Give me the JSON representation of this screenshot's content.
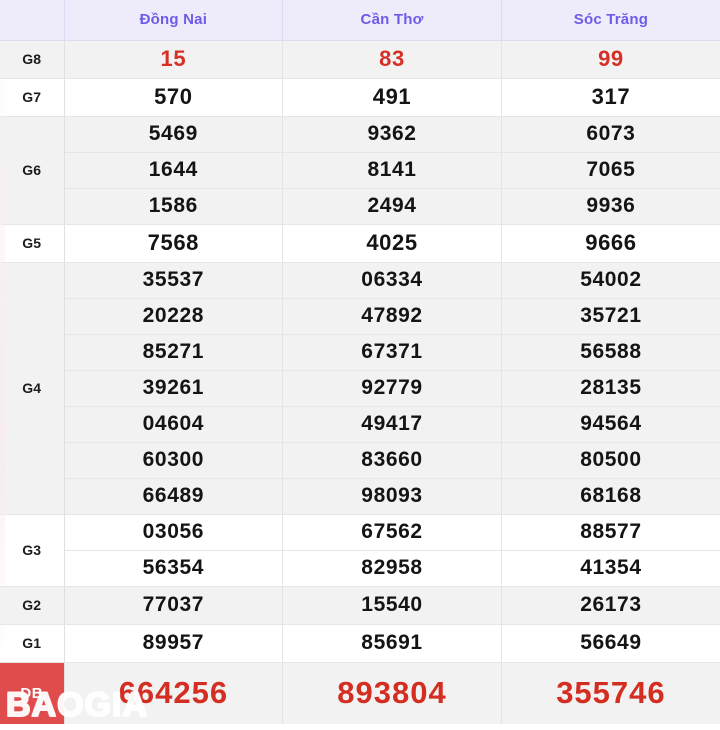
{
  "table": {
    "columns": [
      {
        "label": "Đồng Nai"
      },
      {
        "label": "Cần Thơ"
      },
      {
        "label": "Sóc Trăng"
      }
    ],
    "rows": [
      {
        "label": "G8",
        "style": "red",
        "shade": "shade",
        "values": [
          [
            "15"
          ],
          [
            "83"
          ],
          [
            "99"
          ]
        ]
      },
      {
        "label": "G7",
        "style": "g7",
        "shade": "plain",
        "values": [
          [
            "570"
          ],
          [
            "491"
          ],
          [
            "317"
          ]
        ]
      },
      {
        "label": "G6",
        "style": "normal",
        "shade": "shade",
        "values": [
          [
            "5469",
            "1644",
            "1586"
          ],
          [
            "9362",
            "8141",
            "2494"
          ],
          [
            "6073",
            "7065",
            "9936"
          ]
        ]
      },
      {
        "label": "G5",
        "style": "g5",
        "shade": "plain",
        "values": [
          [
            "7568"
          ],
          [
            "4025"
          ],
          [
            "9666"
          ]
        ]
      },
      {
        "label": "G4",
        "style": "normal",
        "shade": "shade",
        "values": [
          [
            "35537",
            "20228",
            "85271",
            "39261",
            "04604",
            "60300",
            "66489"
          ],
          [
            "06334",
            "47892",
            "67371",
            "92779",
            "49417",
            "83660",
            "98093"
          ],
          [
            "54002",
            "35721",
            "56588",
            "28135",
            "94564",
            "80500",
            "68168"
          ]
        ]
      },
      {
        "label": "G3",
        "style": "normal",
        "shade": "plain",
        "values": [
          [
            "03056",
            "56354"
          ],
          [
            "67562",
            "82958"
          ],
          [
            "88577",
            "41354"
          ]
        ]
      },
      {
        "label": "G2",
        "style": "normal",
        "shade": "shade",
        "values": [
          [
            "77037"
          ],
          [
            "15540"
          ],
          [
            "26173"
          ]
        ]
      },
      {
        "label": "G1",
        "style": "normal",
        "shade": "plain",
        "values": [
          [
            "89957"
          ],
          [
            "85691"
          ],
          [
            "56649"
          ]
        ]
      },
      {
        "label": "DB",
        "style": "db",
        "shade": "shade",
        "values": [
          [
            "664256"
          ],
          [
            "893804"
          ],
          [
            "355746"
          ]
        ]
      }
    ]
  },
  "watermark": {
    "text": "BAOGIA"
  },
  "colors": {
    "header_bg": "#eeecfb",
    "header_text": "#6c5ce7",
    "shade_bg": "#f2f2f2",
    "plain_bg": "#ffffff",
    "number_text": "#141414",
    "highlight_red": "#d63026",
    "special_red": "#d42d21",
    "db_badge_bg": "#e04b4b"
  }
}
